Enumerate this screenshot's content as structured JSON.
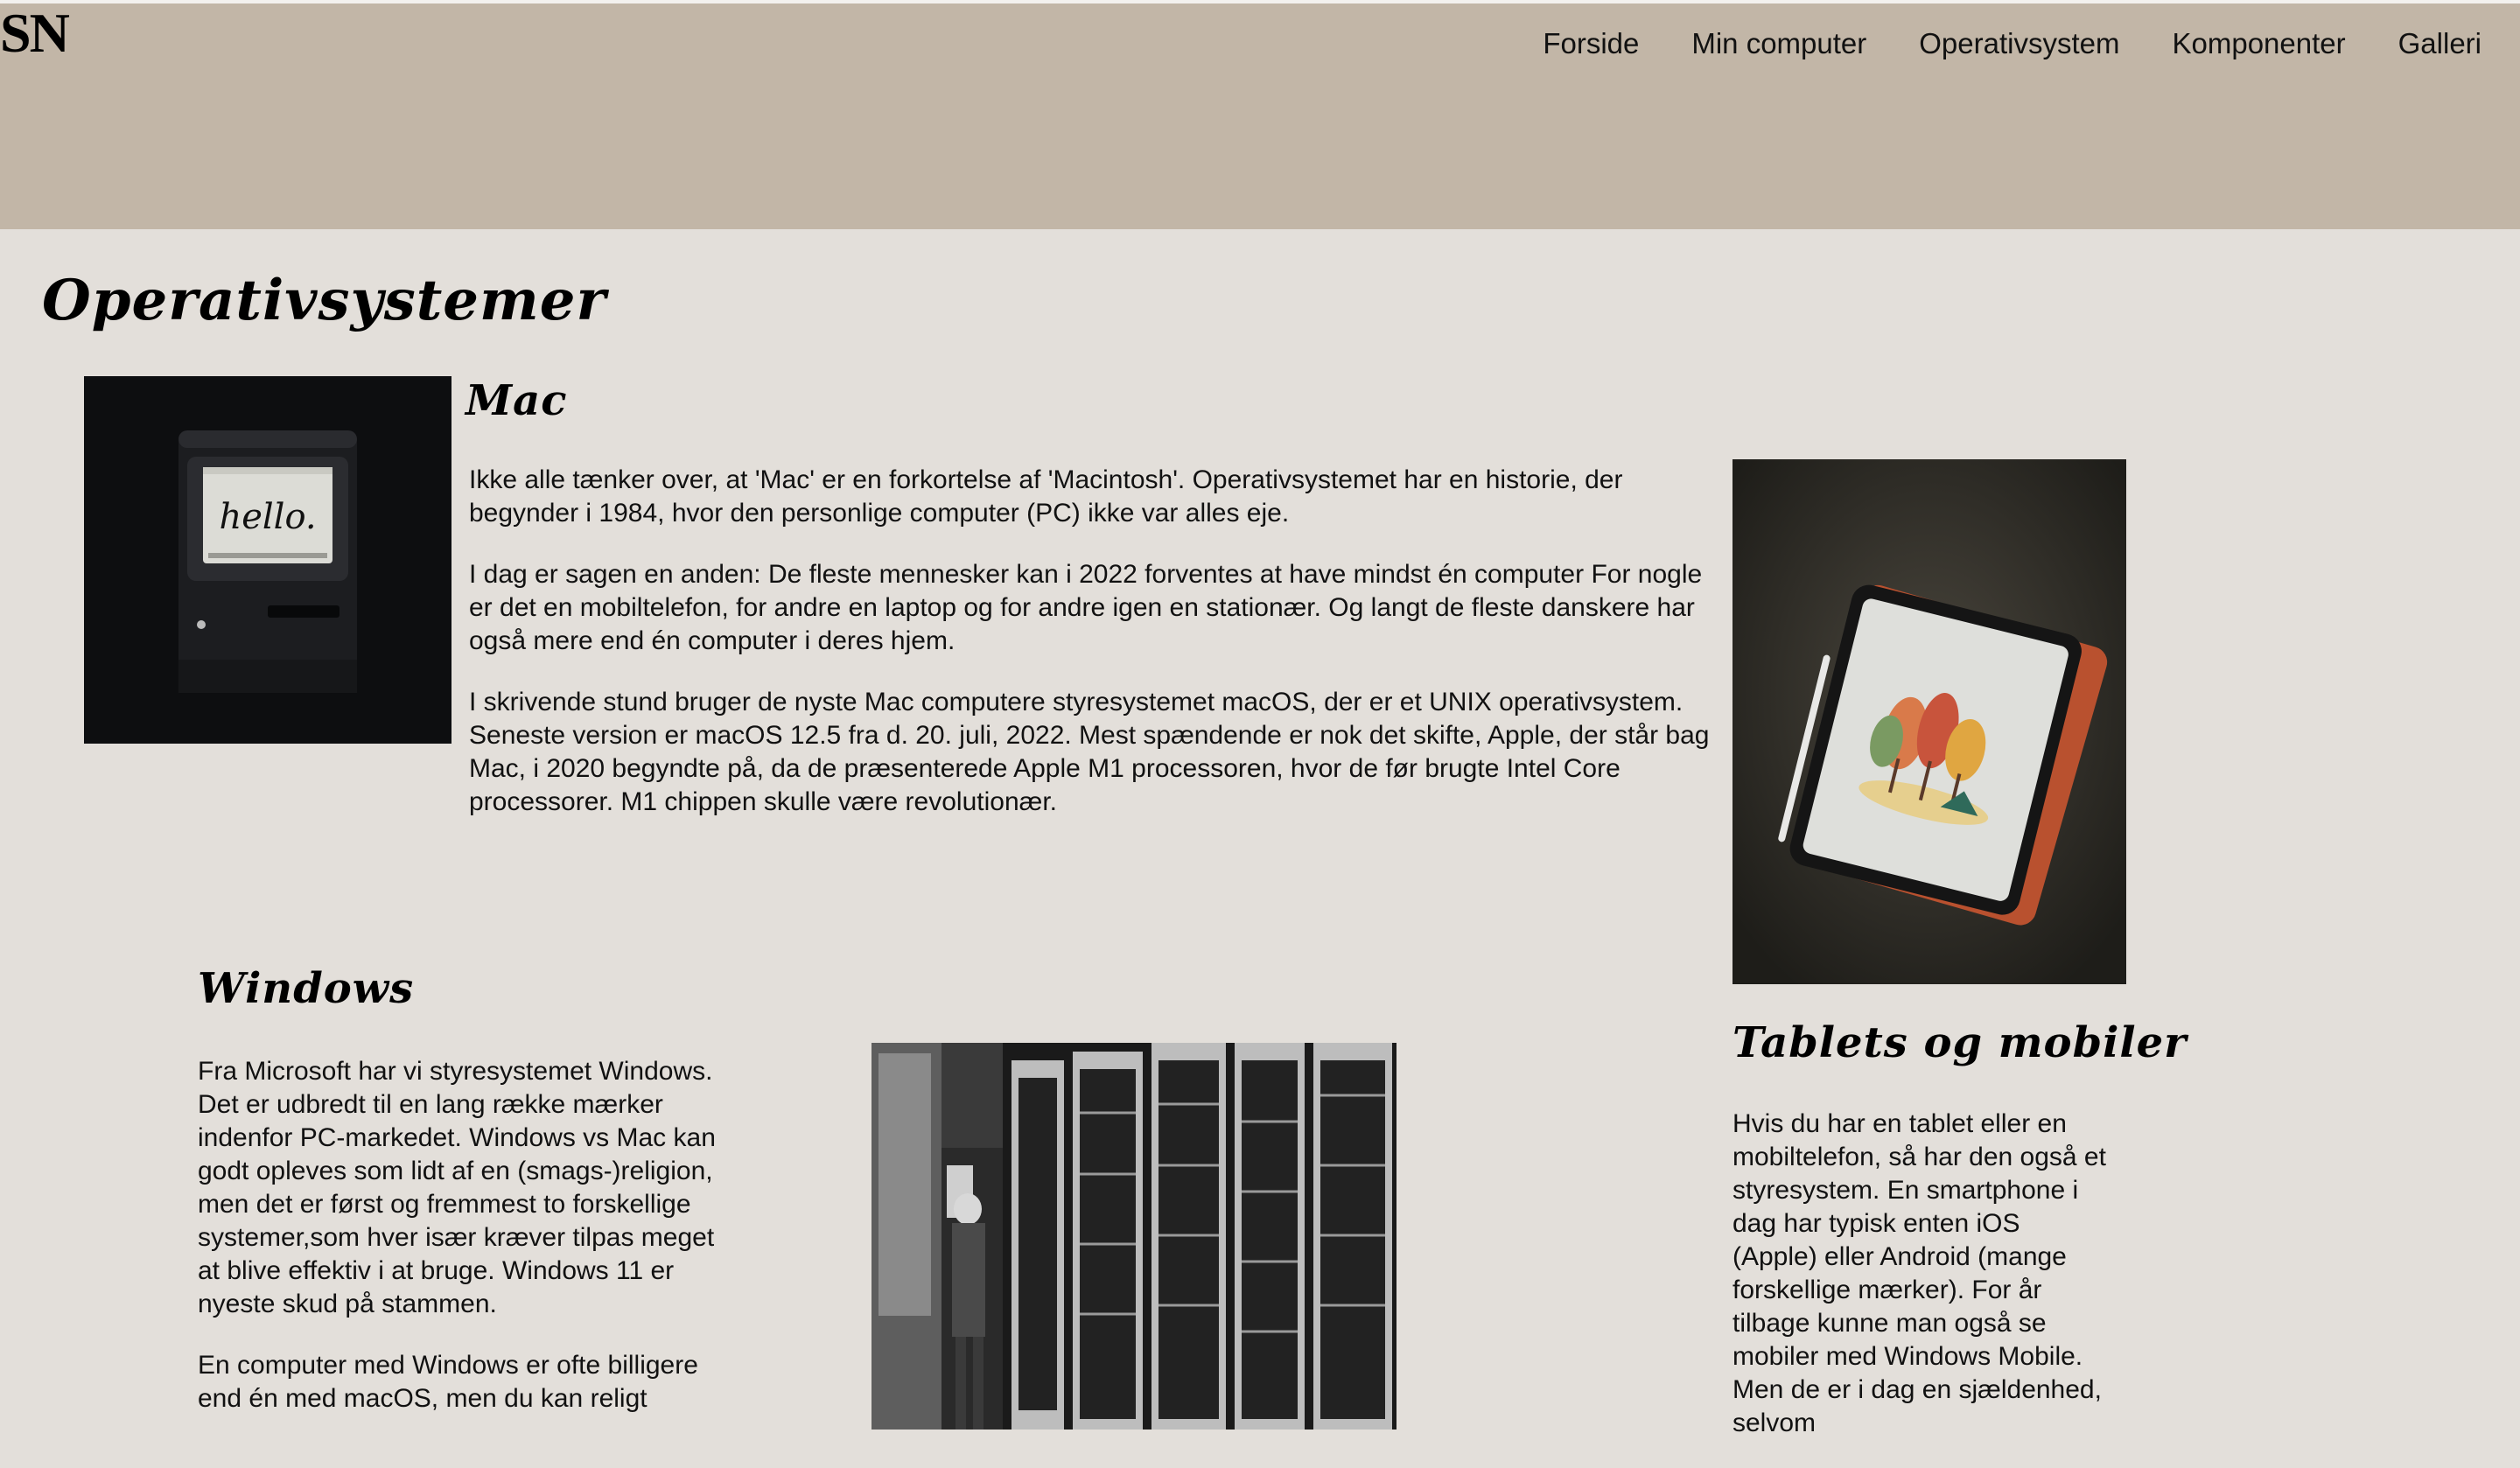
{
  "header": {
    "logo": "SN",
    "nav": [
      "Forside",
      "Min computer",
      "Operativsystem",
      "Komponenter",
      "Galleri"
    ]
  },
  "main": {
    "title": "Operativsystemer",
    "mac": {
      "heading": "Mac",
      "screen_text": "hello.",
      "paragraphs": [
        "Ikke alle tænker over, at 'Mac' er en forkortelse af 'Macintosh'. Operativsystemet har en historie, der begynder i 1984, hvor den personlige computer (PC) ikke var alles eje.",
        "I dag er sagen en anden: De fleste mennesker kan i 2022 forventes at have mindst én computer For nogle er det en mobiltelefon, for andre en laptop og for andre igen en stationær. Og langt de fleste danskere har også mere end én computer i deres hjem.",
        "I skrivende stund bruger de nyste Mac computere styresystemet macOS, der er et UNIX operativsystem. Seneste version er macOS 12.5 fra d. 20. juli, 2022. Mest spændende er nok det skifte, Apple, der står bag Mac, i 2020 begyndte på, da de præsenterede Apple M1 processoren, hvor de før brugte Intel Core processorer. M1 chippen skulle være revolutionær."
      ]
    },
    "windows": {
      "heading": "Windows",
      "paragraphs": [
        "Fra Microsoft har vi styresystemet Windows. Det er udbredt til en lang række mærker indenfor PC-markedet. Windows vs Mac kan godt opleves som lidt af en (smags-)religion, men det er først og fremmest to forskellige systemer,som hver især kræver tilpas meget at blive effektiv i at bruge. Windows 11 er nyeste skud på stammen.",
        "En computer med Windows er ofte billigere end én med macOS, men du kan religt"
      ]
    },
    "tablets": {
      "heading": "Tablets og mobiler",
      "paragraphs": [
        "Hvis du har en tablet eller en mobiltelefon, så har den også et styresystem. En smartphone i dag har typisk enten iOS (Apple) eller Android (mange forskellige mærker). For år tilbage kunne man også se mobiler med Windows Mobile. Men de er i dag en sjældenhed, selvom"
      ]
    }
  },
  "colors": {
    "header_bg": "#c2b6a7",
    "page_bg": "#e3dfda",
    "text": "#111111"
  }
}
